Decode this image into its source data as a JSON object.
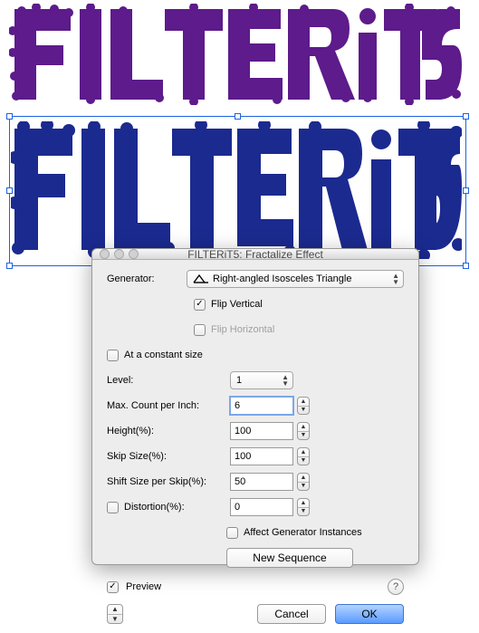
{
  "dialog": {
    "title": "FILTERiT5: Fractalize Effect",
    "generator_label": "Generator:",
    "generator_value": "Right-angled Isosceles Triangle",
    "flip_vertical": {
      "label": "Flip Vertical",
      "checked": true
    },
    "flip_horizontal": {
      "label": "Flip Horizontal",
      "checked": false
    },
    "constant_size": {
      "label": "At a constant size",
      "checked": false
    },
    "level": {
      "label": "Level:",
      "value": "1"
    },
    "max_count": {
      "label": "Max. Count per Inch:",
      "value": "6"
    },
    "height": {
      "label": "Height(%):",
      "value": "100"
    },
    "skip": {
      "label": "Skip Size(%):",
      "value": "100"
    },
    "shift": {
      "label": "Shift Size per Skip(%):",
      "value": "50"
    },
    "distortion": {
      "label": "Distortion(%):",
      "value": "0",
      "checked": false
    },
    "affect_instances": {
      "label": "Affect Generator Instances",
      "checked": false
    },
    "new_sequence": "New Sequence",
    "preview": {
      "label": "Preview",
      "checked": true
    },
    "cancel": "Cancel",
    "ok": "OK"
  },
  "art": {
    "text": "FILTERiT5",
    "color_top": "#5d1b8b",
    "color_bottom": "#1b2a8f",
    "selection_color": "#1e62e2"
  }
}
